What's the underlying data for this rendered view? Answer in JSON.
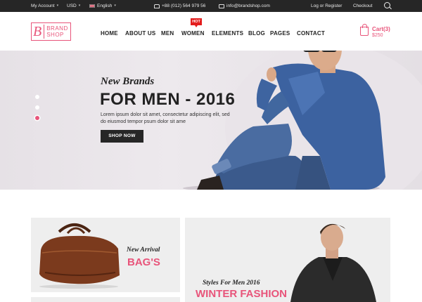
{
  "topbar": {
    "account": "My Account",
    "currency": "USD",
    "language": "English",
    "phone": "+88 (012) 564 979 56",
    "email": "info@brandshop.com",
    "login": "Log or Register",
    "checkout": "Checkout"
  },
  "logo": {
    "letter": "B",
    "line1": "BRAND",
    "line2": "SHOP"
  },
  "nav": {
    "items": [
      "HOME",
      "ABOUT US",
      "MEN",
      "WOMEN",
      "ELEMENTS",
      "BLOG",
      "PAGES",
      "CONTACT"
    ],
    "badge": "HOT"
  },
  "cart": {
    "label": "Cart(3)",
    "total": "$250"
  },
  "hero": {
    "kicker": "New Brands",
    "title": "FOR MEN - 2016",
    "description": "Lorem ipsum dolor sit amet, consectetur adipiscing elit, sed do eiusmod tempor psum dolor sit ame",
    "button": "SHOP NOW",
    "slides": 3,
    "active_slide": 3
  },
  "promos": {
    "bags": {
      "kicker": "New Arrival",
      "title": "BAG'S"
    },
    "fashion": {
      "kicker": "Styles For Men 2016",
      "title": "WINTER FASHION"
    }
  },
  "colors": {
    "accent": "#e8547a",
    "topbar": "#262626",
    "hot": "#e31d1d"
  }
}
